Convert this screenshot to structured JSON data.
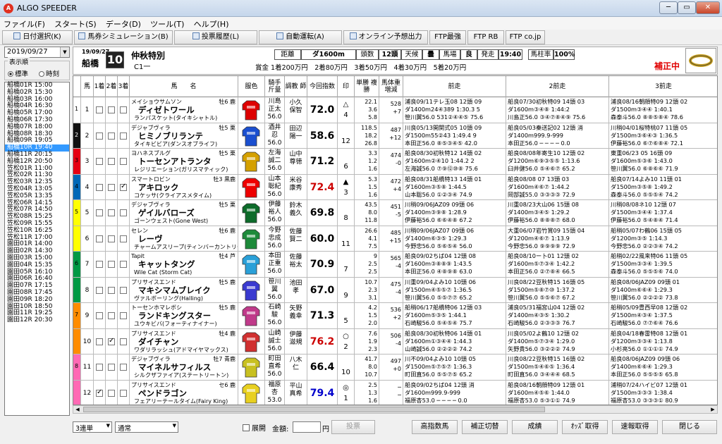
{
  "window": {
    "title": "ALGO SPEEDER"
  },
  "menu": [
    "ファイル(F)",
    "スタート(S)",
    "データ(D)",
    "ツール(T)",
    "ヘルプ(H)"
  ],
  "toolbar": [
    "日付選択(K)",
    "馬券シミュレーション(B)",
    "投票履歴(L)",
    "自動運転(A)",
    "オンライン予想出力",
    "FTP最強",
    "FTP RB",
    "FTP co.jp"
  ],
  "left": {
    "date": "2019/09/27",
    "order_label": "表示順",
    "opt1": "標準",
    "opt2": "時刻",
    "races": [
      "船橋01R 15:00",
      "船橋02R 15:30",
      "船橋03R 16:00",
      "船橋04R 16:30",
      "船橋05R 17:00",
      "船橋06R 17:30",
      "船橋07R 18:00",
      "船橋08R 18:30",
      "船橋09R 19:05",
      "船橋10R 19:40",
      "船橋11R 20:15",
      "船橋12R 20:50",
      "笠松01R 11:00",
      "笠松02R 11:30",
      "笠松03R 12:35",
      "笠松04R 13:05",
      "笠松05R 13:35",
      "笠松06R 14:15",
      "笠松07R 14:50",
      "笠松08R 15:25",
      "笠松09R 15:55",
      "笠松10R 16:25",
      "笠松11R 17:00",
      "園田01R 14:00",
      "園田02R 14:30",
      "園田03R 15:00",
      "園田04R 15:35",
      "園田05R 16:10",
      "園田06R 16:40",
      "園田07R 17:15",
      "園田08R 17:45",
      "園田09R 18:20",
      "園田10R 18:50",
      "園田11R 19:25",
      "園田12R 20:30"
    ],
    "selected": "船橋10R 19:40"
  },
  "race": {
    "date": "19/09/27",
    "track": "船橋",
    "num": "10",
    "name": "仲秋特別",
    "cls": "C1一",
    "kyori_l": "距離",
    "kyori": "ダ1600m",
    "tosu_l": "頭数",
    "tosu": "12頭",
    "tenko_l": "天候",
    "tenko": "曇",
    "baba_l": "馬場",
    "baba": "良",
    "hasso_l": "発走",
    "hasso": "19:40",
    "baba2_l": "馬柱率",
    "baba2": "100%",
    "prize": "賞金 1着200万円　2着80万円　3着50万円　4着30万円　5着20万円",
    "hosei": "補正中"
  },
  "columns": [
    "馬",
    "1着",
    "2着",
    "3着",
    "馬　　名",
    "服色",
    "騎手\n斤量",
    "調教\n師",
    "今回指数",
    "印",
    "単勝\n複勝",
    "馬体重\n増減",
    "前走",
    "2前走",
    "3前走"
  ],
  "horses": [
    {
      "waku": "1",
      "uma": "1",
      "sire": "メイショウサムソン",
      "sex": "牡6 鹿",
      "name": "ディゼトワール",
      "dam": "ランパスケット(タイキシャトル)",
      "jockey": "川島\n正太\n56.0",
      "trainer": "小久\n保智",
      "idx": "72.0",
      "idxc": "#000",
      "mark": "△\n4",
      "odds": "22.1\n3.6\n5.8",
      "wt": "528\n+7",
      "p1": "浦良09/11テレ玉08 12頭 09\nダ1400m24④389 1:30.3 5\n笹川翼56.0 531②④④⑤ 75.6",
      "p2": "船良07/30初秋特09 14頭 03\nダ1600m③④⑧ 1:44:2\n川島正56.0 ③④⑦⑧④⑨ 75.6",
      "p3": "浦良08/16朝顔特09 12頭 02\nダ1500m③④④ 1:40.1\n森泰斗56.0 ⑧⑧⑤⑧④ 78.6"
    },
    {
      "waku": "2",
      "uma": "2",
      "sire": "デジャブヴィラ",
      "sex": "牡5 栗",
      "name": "ヒミノブリランテ",
      "dam": "タイキビビア(ダンスオブライフ)",
      "jockey": "酒井\n忍\n56.0",
      "trainer": "田辺\n陽一",
      "idx": "58.6",
      "idxc": "#000",
      "mark": "\n12",
      "odds": "118.5\n18.2\n26.8",
      "wt": "487\n+12",
      "p1": "川良05/13開関式05 10頭 09\nダ1500m55②43 1:49.4 9\n本田正56.0 ⑧⑤③④⑤ 42.0",
      "p2": "船良05/03秦送記02 12頭 消\nダ1400m999.9-999\n本田正56.0 ─ ─ ─ ─ 0.0",
      "p3": "川稍04/01桜特桃07 11頭 05\nダ1500m③⑥④③ 1:36.5\n伊藤裕56.0 ⑥⑦⑥⑧④ 72.1"
    },
    {
      "waku": "3",
      "uma": "3",
      "sire": "ヨハネスブルグ",
      "sex": "牡5 栗",
      "name": "トーセンアトランタ",
      "dam": "レジリエーション(ガリスマティック)",
      "jockey": "左海\n誠二\n56.0",
      "trainer": "山中\n尊徳",
      "idx": "71.2",
      "idxc": "#000",
      "mark": "\n6",
      "odds": "3.3\n1.2\n1.6",
      "wt": "474\n-0",
      "p1": "船良08/30初秋特12 14頭 02\nダ1600m②④10 1:44.2 2\n左海誠56.0 ⑦⑨⑫⑩⑧ 75.6",
      "p2": "船良08/08年寄生10 12頭 02\nダ1200m⑥⑨③⑤⑤ 1:13.6\n臼井健56.0 ⑤④⑥⑦ 65.2",
      "p3": "東重06/23 05 16頭 09\nダ1600m⑤③⑥ 1:43.0\n笹川翼56.0 ⑥⑧⑥⑥ 71.9"
    },
    {
      "waku": "4",
      "uma": "4",
      "sire": "スマートロビン",
      "sex": "牡3 黒鹿",
      "name": "アキロック",
      "dam": "コケッサ(クライアスメタイム)",
      "jockey": "山本\n聡紀\n56.0",
      "trainer": "米谷\n康秀",
      "idx": "72.4",
      "idxc": "#cc0000",
      "mark": "▲\n3",
      "odds": "5.3\n1.5\n1.6",
      "wt": "472\n+4",
      "p1": "船良08/31船橋特13 14頭 01\nダ1600m③⑤⑧ 1:44.5\n山本聡56.0 ①②③④ 74.9",
      "p2": "船良08/08 07 13頭 03\nダ1600m④⑥⑦ 1:44.2\n岡部誠55.0 ③③③③ 72.9",
      "p3": "船良07/14よみ10 11頭 01\nダ1500m③⑤⑧ 1:49.2\n森泰斗56.0 ⑤⑤⑤④ 74.2"
    },
    {
      "waku": "5",
      "uma": "5",
      "sire": "デジャブヴィラ",
      "sex": "牡5 栗",
      "name": "ゲイルバローズ",
      "dam": "ゴーンウェスト(Gone West)",
      "jockey": "伊藤\n裕人\n56.0",
      "trainer": "鈴木\n義久",
      "idx": "69.8",
      "idxc": "#000",
      "mark": "\n8",
      "odds": "43.5\n8.0\n11.8",
      "wt": "451\n-5",
      "p1": "川稍09/06JAZ09 09頭 06\nダ1400m③⑨⑧ 1:28.9\n伊藤裕56.0 ⑥⑥④⑧ 67.2",
      "p2": "川重08/23大山06 15頭 08\nダ1400m③④⑤ 1:29.2\n伊藤裕56.0 ⑧⑧⑧⑦ 68.0",
      "p3": "川稍08/08ネ10 12頭 07\nダ1500m③④④ 1:37.4\n伊藤裕56.0 ⑤④⑧④ 71.4"
    },
    {
      "waku": "5",
      "uma": "6",
      "sire": "セレン",
      "sex": "牡6 鹿",
      "name": "レーヴ",
      "dam": "チャームアスリープ(ティンバーカントリー)",
      "jockey": "今野\n忠成\n56.0",
      "trainer": "佐藤\n賢二",
      "idx": "60.0",
      "idxc": "#000",
      "mark": "\n11",
      "odds": "26.6\n4.1\n7.5",
      "wt": "485\n+15",
      "p1": "川稍09/06JAZ07 09頭 06\nダ1400m⑥③⑤ 1:29.3\n今野忠56.0 ⑤⑥⑤④ 56.0",
      "p2": "大重06/07岩竹賞09 15頭 04\nダ1200m④⑥⑦ 1:13.9\n今野忠56.0 ⑨⑨⑨⑨ 72.9",
      "p3": "船稍05/07わ鶴06 15頭 05\nダ1200m③⑤ 1:14.3\n今野忠56.0 ②②③④ 74.2"
    },
    {
      "waku": "6",
      "uma": "7",
      "sire": "Tapit",
      "sex": "牡4 芦",
      "name": "キャットタング",
      "dam": "Wile Cat (Storm Cat)",
      "jockey": "本田\n正重\n56.0",
      "trainer": "佐藤\n裕太",
      "idx": "70.9",
      "idxc": "#000",
      "mark": "\n7",
      "odds": "9\n2.5\n2.5",
      "wt": "565\n-4",
      "p1": "船良09/02ちば04 12頭 08\nダ1600m③⑧⑧⑨ 1:43.5\n本田正56.0 ④⑧⑨⑧ 63.0",
      "p2": "船良08/10ー卜01 12頭 02\nダ1600m⑤⑦③④ 1:42.2\n本田正56.0 ②⑦⑧④ 66.5",
      "p3": "船稍02/22風来特06 11頭 05\nダ1500m③③④ 1:39.5\n森泰斗56.0 ⑤⑤⑤⑥ 74.0"
    },
    {
      "waku": "6",
      "uma": "8",
      "sire": "プリサイスエンド",
      "sex": "牡5 鹿",
      "name": "マキシマムブレイク",
      "dam": "ヴァルボーリング(Halling)",
      "jockey": "笹川\n翼\n56.0",
      "trainer": "池田\n孝",
      "idx": "67.0",
      "idxc": "#000",
      "mark": "\n9",
      "odds": "10.7\n2.3\n3.1",
      "wt": "475\n-4",
      "p1": "川重09/04よみ10 10頭 06\nダ1500m④⑤⑤⑦ 1:36.5\n笹川翼56.0 ⑤⑤⑦⑦ 65.2",
      "p2": "川良08/22豆秋特15 16頭 05\nダ1500m⑤⑧⑦⑩ 1:37.2\n笹川翼56.0 ⑤⑤⑥⑦ 67.2",
      "p3": "船良08/06JAZ09 09頭 01\nダ1400m⑥⑥④ 1:29.3\n笹川翼56.0 ②②②② 73.8"
    },
    {
      "waku": "7",
      "uma": "9",
      "sire": "トーセンホマレボシ",
      "sex": "牡5 鹿",
      "name": "ランドキングスター",
      "dam": "ユウキビバ(フォーティナイナー)",
      "jockey": "石崎\n駿\n56.0",
      "trainer": "矢野\n義幸",
      "idx": "71.3",
      "idxc": "#000",
      "mark": "\n5",
      "odds": "4.2\n1.5\n2.0",
      "wt": "536\n+2",
      "p1": "船稍06/17船橋特06 12頭 03\nダ1600m⑤③⑤ 1:44.1\n石崎駿56.0 ⑤④⑤④ 75.7",
      "p2": "浦良05/31福宮山04 12頭 02\nダ1400m④③⑤ 1:30.2\n石崎駿56.0 ②③③③ 76.7",
      "p3": "船稍05/09豊西早08 12頭 02\nダ1500m④③④ 1:37.5\n石崎駿56.0 ⑦⑦⑥④ 76.6"
    },
    {
      "waku": "7",
      "uma": "10",
      "sire": "プリサイスエンド",
      "sex": "牡4 鹿",
      "name": "ダイチャン",
      "dam": "ワダリラッシュ(アドマイヤマックス)",
      "jockey": "山崎\n誠士\n56.0",
      "trainer": "伊藤\n滋規",
      "idx": "76.2",
      "idxc": "#cc0000",
      "mark": "○\n2",
      "odds": "7.6\n1.9\n2.3",
      "wt": "506\n-4",
      "p1": "船良08/30初秋特06 14頭 01\nダ1600m①③④④ 1:44.3\n山崎誠56.0 ②②②② 74.2",
      "p2": "川良05/02よ鶴10 12頭 02\nダ1400m⑤⑦③④ 1:29.0\n矢野貴56.0 ③②②② 74.9",
      "p3": "船良04/18春雷特08 12頭 01\nダ1200m③③④ 1:13.8\n小杉亮56.0 ①①①① 74.9"
    },
    {
      "waku": "8",
      "uma": "11",
      "sire": "デジャブヴィラ",
      "sex": "牡7 青鹿",
      "name": "マイネルサフィルス",
      "dam": "シルクザファイア(ステートリートン)",
      "jockey": "町田\n直希\n56.0",
      "trainer": "八木\n仁",
      "idx": "66.4",
      "idxc": "#000",
      "mark": "\n10",
      "odds": "41.7\n8.0\n10.7",
      "wt": "497\n+0",
      "p1": "川不09/04よみ10 10頭 05\nダ1500m⑤⑦⑤⑦ 1:36.3\n町田直56.0 ⑤⑤⑦⑤ 65.2",
      "p2": "川良08/22豆秋特15 16頭 02\nダ1500m⑤④⑥⑤ 1:36.4\n町田直56.0 ③④④④ 68.5",
      "p3": "船良08/06JAZ09 09頭 06\nダ1400m⑥⑥④ 1:29.3\n本田正56.0 ⑤⑤⑤⑤ 65.8"
    },
    {
      "waku": "8",
      "uma": "12",
      "sire": "プリサイスエンド",
      "sex": "セ6 鹿",
      "name": "ペンドラゴン",
      "dam": "フェアリーテールタイム(Fairy King)",
      "jockey": "福原\n杏\n53.0",
      "trainer": "平山\n真希",
      "idx": "79.4",
      "idxc": "#0000cc",
      "mark": "◎\n1",
      "odds": "2.5\n1.3\n1.6",
      "wt": "─\n─",
      "p1": "船良09/02ちば04 12頭 消\nダ1600m999.9-999\n福原杏53.0 ─ ─ ─ ─ 0.0",
      "p2": "船良08/16朝顔特09 12頭 01\nダ1600m④⑤⑥ 1:44.0\n福原杏53.0 ⑤③①① 74.9",
      "p3": "浦稍07/24ハイビ07 12頭 01\nダ1500m③③③ 1:38.4\n福原杏53.0 ③③③① 80.9"
    }
  ],
  "bottom": {
    "bet_type": "3連単",
    "mode": "通常",
    "tenkai": "展開",
    "kingaku": "金額:",
    "yen": "円",
    "tohyo": "投票",
    "btns": [
      "高指数馬",
      "補正切替",
      "成績",
      "ｵｯｽﾞ取得",
      "速報取得",
      "閉じる"
    ]
  },
  "colors": {
    "accent": "#3399ff",
    "waku": [
      "#ffffff",
      "#111111",
      "#e60012",
      "#0068b7",
      "#ffff00",
      "#009944",
      "#ff8c00",
      "#ff69b4"
    ]
  }
}
